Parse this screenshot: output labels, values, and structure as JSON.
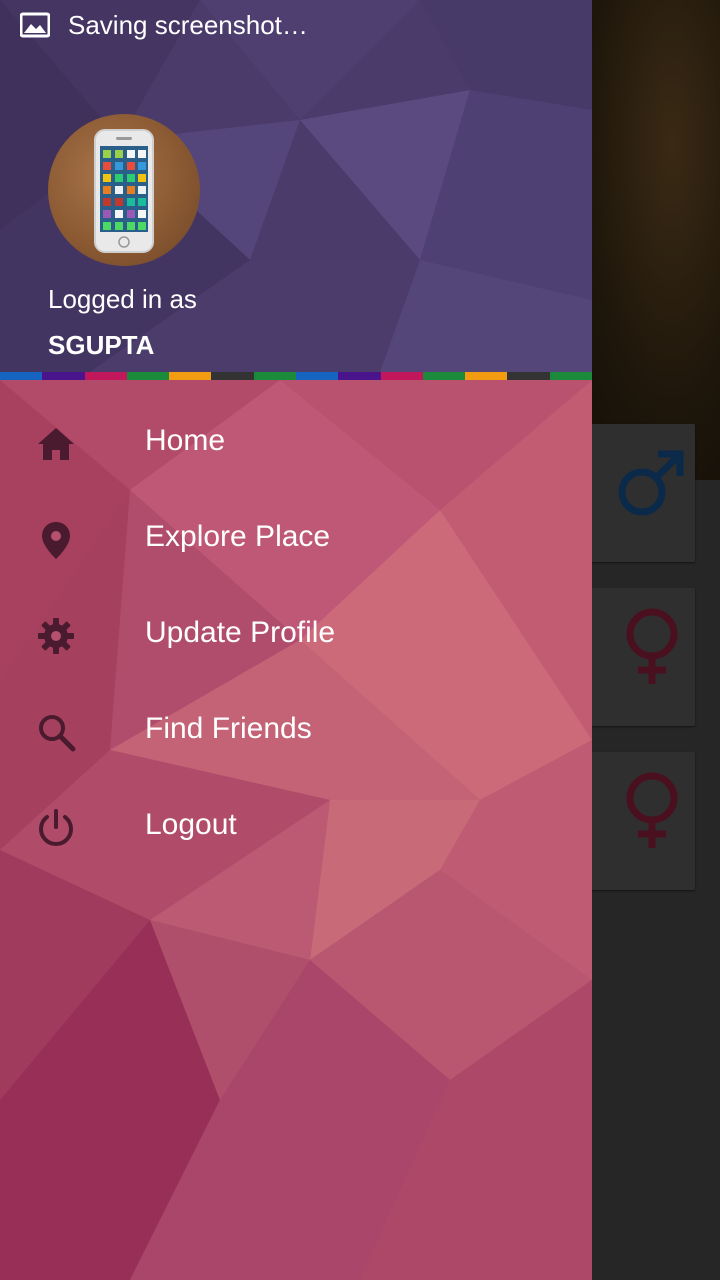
{
  "status_bar": {
    "notification_icon": "image-icon",
    "text": "Saving screenshot…"
  },
  "drawer": {
    "header": {
      "avatar_icon": "phone-avatar",
      "logged_in_label": "Logged in as",
      "username": "SGUPTA"
    },
    "rainbow_colors": [
      "#1565c0",
      "#4a148c",
      "#c2185b",
      "#1b8a3a",
      "#f39c12",
      "#333333",
      "#1b8a3a",
      "#1565c0",
      "#4a148c",
      "#c2185b",
      "#1b8a3a",
      "#f39c12",
      "#333333",
      "#1b8a3a"
    ],
    "menu": [
      {
        "label": "Home",
        "icon": "home-icon"
      },
      {
        "label": "Explore Place",
        "icon": "location-pin-icon"
      },
      {
        "label": "Update Profile",
        "icon": "gear-icon"
      },
      {
        "label": "Find Friends",
        "icon": "search-icon"
      },
      {
        "label": "Logout",
        "icon": "power-icon"
      }
    ]
  },
  "background_app": {
    "cards": [
      {
        "icon": "male-symbol-icon",
        "color": "#0b2a4a"
      },
      {
        "icon": "female-symbol-icon",
        "color": "#4a1020"
      },
      {
        "icon": "female-symbol-icon",
        "color": "#4a1020"
      }
    ]
  },
  "colors": {
    "header_bg": "#4a3b6b",
    "menu_bg": "#b5506f",
    "icon_color": "#4a1a2e"
  }
}
